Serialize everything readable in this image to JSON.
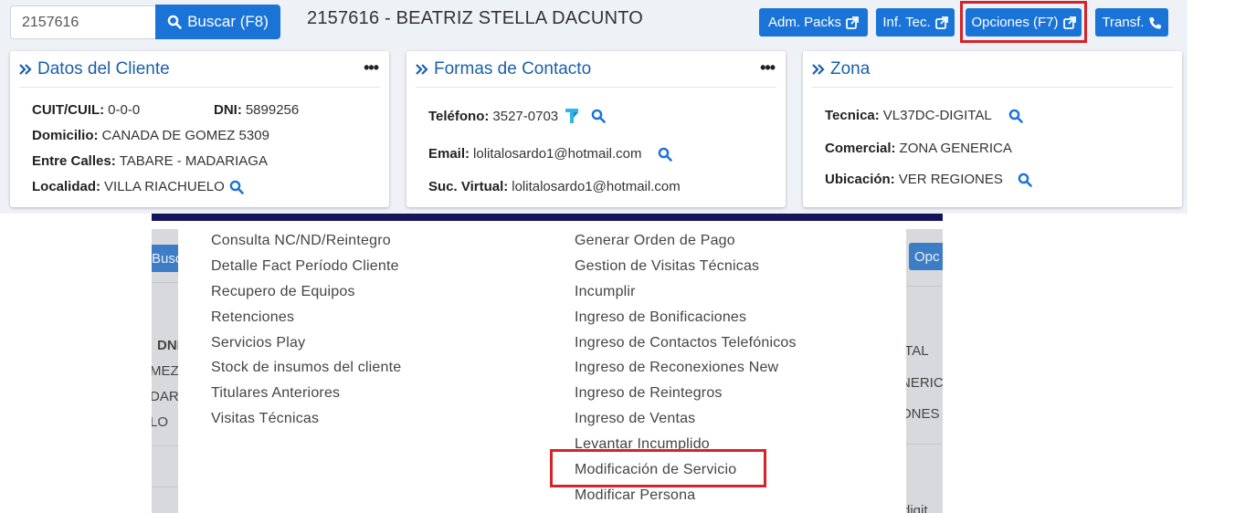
{
  "search": {
    "value": "2157616",
    "button_label": "Buscar (F8)"
  },
  "client": {
    "title": "2157616 - BEATRIZ STELLA DACUNTO"
  },
  "toolbar": {
    "adm_packs": "Adm. Packs",
    "inf_tec": "Inf. Tec.",
    "opciones": "Opciones (F7)",
    "transf": "Transf."
  },
  "datos_cliente": {
    "title": "Datos del Cliente",
    "cuit_label": "CUIT/CUIL:",
    "cuit_value": "0-0-0",
    "dni_label": "DNI:",
    "dni_value": "5899256",
    "domicilio_label": "Domicilio:",
    "domicilio_value": "CANADA DE GOMEZ 5309",
    "entre_calles_label": "Entre Calles:",
    "entre_calles_value": "TABARE - MADARIAGA",
    "localidad_label": "Localidad:",
    "localidad_value": "VILLA RIACHUELO"
  },
  "formas_contacto": {
    "title": "Formas de Contacto",
    "telefono_label": "Teléfono:",
    "telefono_value": "3527-0703",
    "email_label": "Email:",
    "email_value": "lolitalosardo1@hotmail.com",
    "suc_virtual_label": "Suc. Virtual:",
    "suc_virtual_value": "lolitalosardo1@hotmail.com"
  },
  "zona": {
    "title": "Zona",
    "tecnica_label": "Tecnica:",
    "tecnica_value": "VL37DC-DIGITAL",
    "comercial_label": "Comercial:",
    "comercial_value": "ZONA GENERICA",
    "ubicacion_label": "Ubicación:",
    "ubicacion_value": "VER REGIONES"
  },
  "menu": {
    "column_1": [
      "Consulta NC/ND/Reintegro",
      "Detalle Fact Período Cliente",
      "Recupero de Equipos",
      "Retenciones",
      "Servicios Play",
      "Stock de insumos del cliente",
      "Titulares Anteriores",
      "Visitas Técnicas"
    ],
    "column_2": [
      "Generar Orden de Pago",
      "Gestion de Visitas Técnicas",
      "Incumplir",
      "Ingreso de Bonificaciones",
      "Ingreso de Contactos Telefónicos",
      "Ingreso de Reconexiones New",
      "Ingreso de Reintegros",
      "Ingreso de Ventas",
      "Levantar Incumplido",
      "Modificación de Servicio",
      "Modificar Persona"
    ]
  },
  "background_fragments": {
    "left_button": "Buscar",
    "left_1": "DNI",
    "left_2": "MEZ",
    "left_3": "DAR",
    "left_4": "LO",
    "right_button": "Opc",
    "right_1": "ITAL",
    "right_2": "NERIC",
    "right_3": "ONES",
    "right_4": "digit"
  },
  "colors": {
    "primary": "#1a73d6",
    "card_title": "#1a5fa8",
    "highlight": "#d6232a",
    "navy_bar": "#16155a"
  }
}
